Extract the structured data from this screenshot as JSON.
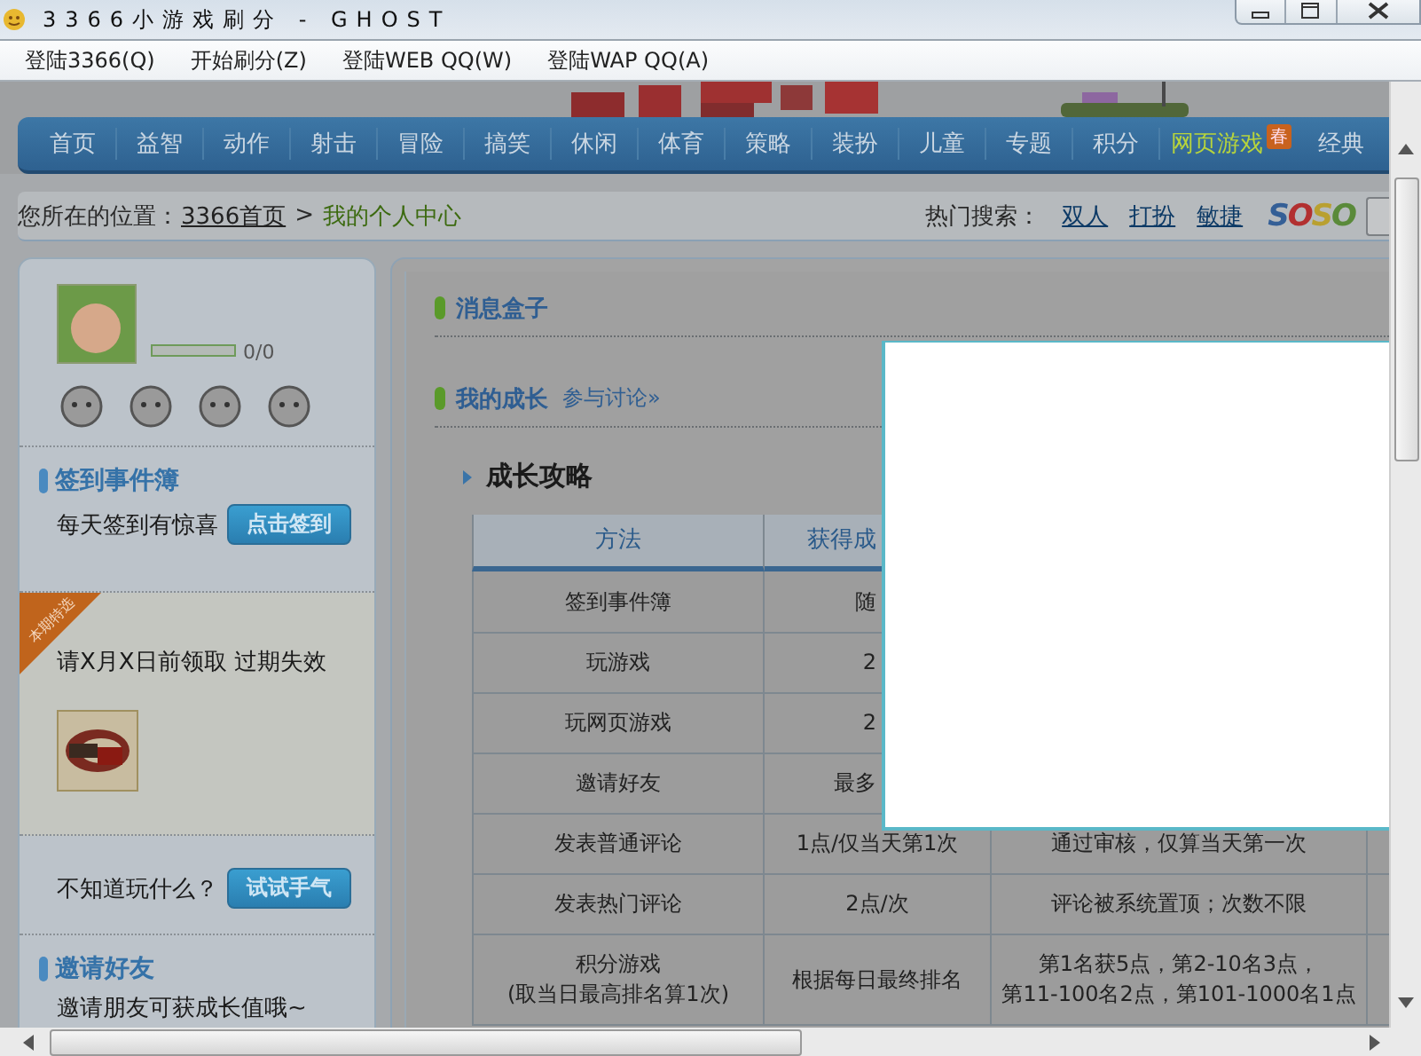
{
  "window": {
    "title": "3366小游戏刷分 - GHOST"
  },
  "menu": [
    {
      "label": "登陆3366(Q)"
    },
    {
      "label": "开始刷分(Z)"
    },
    {
      "label": "登陆WEB QQ(W)"
    },
    {
      "label": "登陆WAP QQ(A)"
    }
  ],
  "nav": [
    {
      "label": "首页",
      "selected": false
    },
    {
      "label": "益智",
      "selected": false
    },
    {
      "label": "动作",
      "selected": false
    },
    {
      "label": "射击",
      "selected": false
    },
    {
      "label": "冒险",
      "selected": false
    },
    {
      "label": "搞笑",
      "selected": false
    },
    {
      "label": "休闲",
      "selected": false
    },
    {
      "label": "体育",
      "selected": false
    },
    {
      "label": "策略",
      "selected": false
    },
    {
      "label": "装扮",
      "selected": false
    },
    {
      "label": "儿童",
      "selected": false
    },
    {
      "label": "专题",
      "selected": false
    },
    {
      "label": "积分",
      "selected": false
    },
    {
      "label": "网页游戏",
      "selected": true,
      "badge": "春"
    },
    {
      "label": "经典",
      "selected": false
    }
  ],
  "breadcrumb": {
    "label": "您所在的位置：",
    "home": "3366首页",
    "separator": ">",
    "current": "我的个人中心"
  },
  "hot_search": {
    "label": "热门搜索：",
    "links": [
      "双人",
      "打扮",
      "敏捷"
    ],
    "logo": "SOSO"
  },
  "sidebar": {
    "profile": {
      "level": 0,
      "reading": "0/0"
    },
    "checkin": {
      "title": "签到事件簿",
      "text": "每天签到有惊喜",
      "button": "点击签到"
    },
    "promo": {
      "ribbon": "本期特选",
      "text": "请X月X日前领取 过期失效"
    },
    "lucky": {
      "text": "不知道玩什么？",
      "button": "试试手气"
    },
    "invite": {
      "title": "邀请好友",
      "text": "邀请朋友可获成长值哦~"
    }
  },
  "main": {
    "sections": [
      {
        "title": "消息盒子"
      },
      {
        "title": "我的成长",
        "link": "参与讨论»"
      }
    ],
    "heading": "成长攻略",
    "table": {
      "columns": [
        "方法",
        "获得成"
      ],
      "rows": [
        {
          "cells": [
            [
              "签到事件簿"
            ],
            [
              "随"
            ]
          ]
        },
        {
          "cells": [
            [
              "玩游戏"
            ],
            [
              "2"
            ]
          ]
        },
        {
          "cells": [
            [
              "玩网页游戏"
            ],
            [
              "2"
            ]
          ]
        },
        {
          "cells": [
            [
              "邀请好友"
            ],
            [
              "最多"
            ]
          ]
        },
        {
          "cells": [
            [
              "发表普通评论"
            ],
            [
              "1点/仅当天第1次"
            ],
            [
              "通过审核，仅算当天第一次"
            ]
          ]
        },
        {
          "cells": [
            [
              "发表热门评论"
            ],
            [
              "2点/次"
            ],
            [
              "评论被系统置顶；次数不限"
            ]
          ]
        },
        {
          "cells": [
            [
              "积分游戏",
              "(取当日最高排名算1次)"
            ],
            [
              "根据每日最终排名"
            ],
            [
              "第1名获5点，第2-10名3点，",
              "第11-100名2点，第101-1000名1点"
            ]
          ]
        }
      ]
    }
  }
}
